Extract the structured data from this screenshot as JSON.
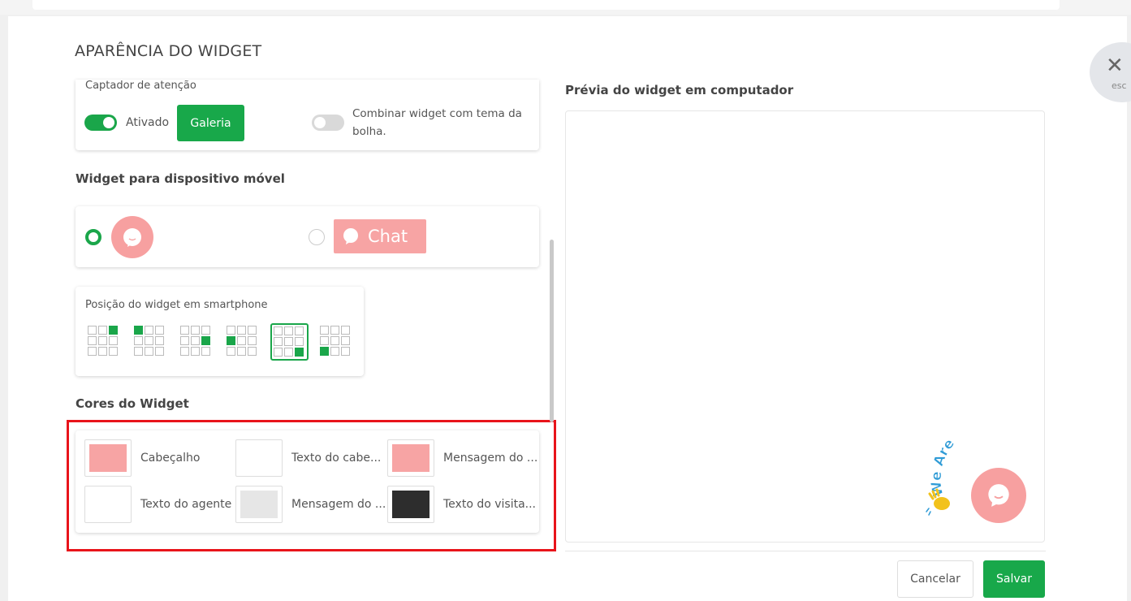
{
  "modal": {
    "title": "APARÊNCIA DO WIDGET",
    "close_hint": "esc"
  },
  "attention": {
    "heading": "Captador de atenção",
    "toggle_label": "Ativado",
    "gallery_button": "Galeria",
    "combine_label_line1": "Combinar widget com tema da",
    "combine_label_line2": "bolha."
  },
  "mobile": {
    "heading": "Widget para dispositivo móvel",
    "chat_button_label": "Chat"
  },
  "position": {
    "heading": "Posição do widget em smartphone",
    "selected_index": 4
  },
  "colors": {
    "heading": "Cores do Widget",
    "items": [
      {
        "label": "Cabeçalho",
        "color": "#f7a4a4"
      },
      {
        "label": "Texto do cabe...",
        "color": "#ffffff"
      },
      {
        "label": "Mensagem do ...",
        "color": "#f7a4a4"
      },
      {
        "label": "Texto do agente",
        "color": "#ffffff"
      },
      {
        "label": "Mensagem do ...",
        "color": "#e6e6e6"
      },
      {
        "label": "Texto do visita...",
        "color": "#2d2d2d"
      }
    ]
  },
  "preview": {
    "title": "Prévia do widget em computador",
    "badge_text": "We Are Here!"
  },
  "footer": {
    "cancel": "Cancelar",
    "save": "Salvar"
  },
  "theme": {
    "accent": "#1aa64a",
    "pink": "#f7a4a4",
    "highlight": "#e8141b"
  }
}
